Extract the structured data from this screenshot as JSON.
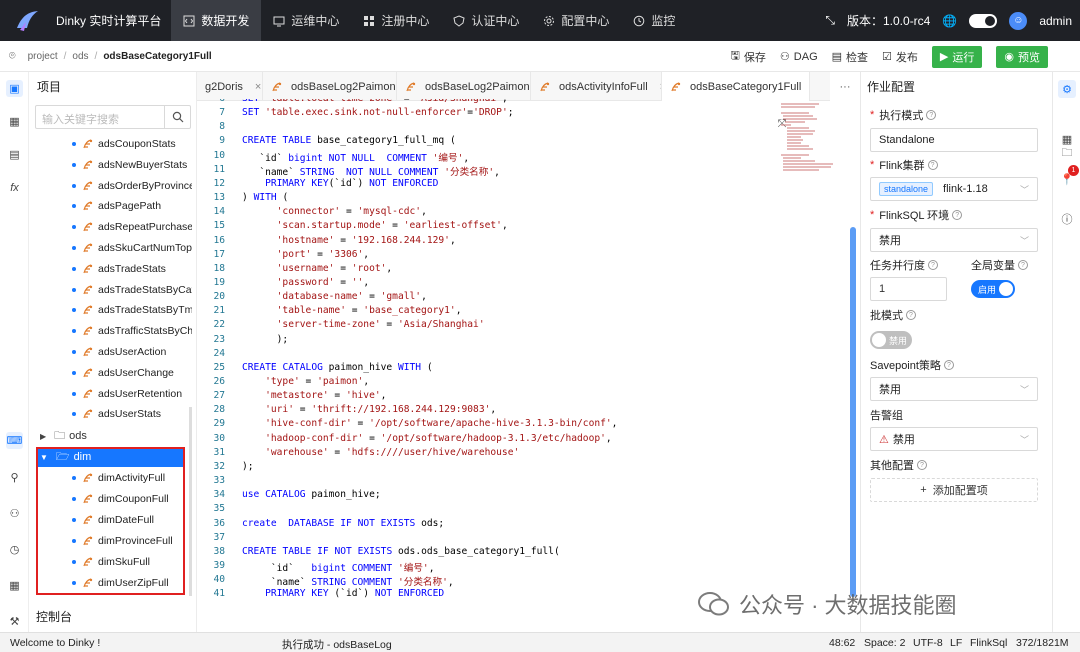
{
  "app": {
    "title": "Dinky 实时计算平台"
  },
  "nav": [
    {
      "label": "数据开发",
      "icon": "code-icon",
      "active": true
    },
    {
      "label": "运维中心",
      "icon": "monitor-icon"
    },
    {
      "label": "注册中心",
      "icon": "grid-icon"
    },
    {
      "label": "认证中心",
      "icon": "shield-icon"
    },
    {
      "label": "配置中心",
      "icon": "gear-icon"
    },
    {
      "label": "监控",
      "icon": "clock-icon"
    }
  ],
  "top_right": {
    "version": "版本：1.0.0-rc4",
    "user": "admin"
  },
  "breadcrumb": [
    "project",
    "ods",
    "odsBaseCategory1Full"
  ],
  "toolbar": {
    "save": "保存",
    "dag": "DAG",
    "check": "检查",
    "publish": "发布",
    "run": "运行",
    "preview": "预览"
  },
  "sidebar": {
    "title": "项目",
    "search_placeholder": "输入关键字搜索",
    "ads_items": [
      "adsCouponStats",
      "adsNewBuyerStats",
      "adsOrderByProvince",
      "adsPagePath",
      "adsRepeatPurchaseE",
      "adsSkuCartNumTop.",
      "adsTradeStats",
      "adsTradeStatsByCate",
      "adsTradeStatsByTm",
      "adsTrafficStatsByCha",
      "adsUserAction",
      "adsUserChange",
      "adsUserRetention",
      "adsUserStats"
    ],
    "folders": {
      "ods": "ods",
      "dim": "dim"
    },
    "dim_items": [
      "dimActivityFull",
      "dimCouponFull",
      "dimDateFull",
      "dimProvinceFull",
      "dimSkuFull",
      "dimUserZipFull"
    ],
    "console": "控制台"
  },
  "tabs": [
    {
      "label": "g2Doris",
      "active": false,
      "icon": false
    },
    {
      "label": "odsBaseLog2Paimon",
      "active": false,
      "icon": true
    },
    {
      "label": "odsBaseLog2Paimon",
      "active": false,
      "icon": true
    },
    {
      "label": "odsActivityInfoFull",
      "active": false,
      "icon": true
    },
    {
      "label": "odsBaseCategory1Full",
      "active": true,
      "icon": true
    }
  ],
  "code_lines": [
    {
      "n": "6",
      "t": "SET 'table.local-time-zone' = 'Asia/Shanghai';"
    },
    {
      "n": "7",
      "t": "SET 'table.exec.sink.not-null-enforcer'='DROP';"
    },
    {
      "n": "8",
      "t": ""
    },
    {
      "n": "9",
      "t": "CREATE TABLE base_category1_full_mq ("
    },
    {
      "n": "10",
      "t": "   `id` bigint NOT NULL  COMMENT '编号',"
    },
    {
      "n": "11",
      "t": "   `name` STRING  NOT NULL COMMENT '分类名称',"
    },
    {
      "n": "12",
      "t": "    PRIMARY KEY(`id`) NOT ENFORCED"
    },
    {
      "n": "13",
      "t": ") WITH ("
    },
    {
      "n": "14",
      "t": "      'connector' = 'mysql-cdc',"
    },
    {
      "n": "15",
      "t": "      'scan.startup.mode' = 'earliest-offset',"
    },
    {
      "n": "16",
      "t": "      'hostname' = '192.168.244.129',"
    },
    {
      "n": "17",
      "t": "      'port' = '3306',"
    },
    {
      "n": "18",
      "t": "      'username' = 'root',"
    },
    {
      "n": "19",
      "t": "      'password' = '',"
    },
    {
      "n": "20",
      "t": "      'database-name' = 'gmall',"
    },
    {
      "n": "21",
      "t": "      'table-name' = 'base_category1',"
    },
    {
      "n": "22",
      "t": "      'server-time-zone' = 'Asia/Shanghai'"
    },
    {
      "n": "23",
      "t": "      );"
    },
    {
      "n": "24",
      "t": ""
    },
    {
      "n": "25",
      "t": "CREATE CATALOG paimon_hive WITH ("
    },
    {
      "n": "26",
      "t": "    'type' = 'paimon',"
    },
    {
      "n": "27",
      "t": "    'metastore' = 'hive',"
    },
    {
      "n": "28",
      "t": "    'uri' = 'thrift://192.168.244.129:9083',"
    },
    {
      "n": "29",
      "t": "    'hive-conf-dir' = '/opt/software/apache-hive-3.1.3-bin/conf',"
    },
    {
      "n": "30",
      "t": "    'hadoop-conf-dir' = '/opt/software/hadoop-3.1.3/etc/hadoop',"
    },
    {
      "n": "31",
      "t": "    'warehouse' = 'hdfs:////user/hive/warehouse'"
    },
    {
      "n": "32",
      "t": ");"
    },
    {
      "n": "33",
      "t": ""
    },
    {
      "n": "34",
      "t": "use CATALOG paimon_hive;"
    },
    {
      "n": "35",
      "t": ""
    },
    {
      "n": "36",
      "t": "create  DATABASE IF NOT EXISTS ods;"
    },
    {
      "n": "37",
      "t": ""
    },
    {
      "n": "38",
      "t": "CREATE TABLE IF NOT EXISTS ods.ods_base_category1_full("
    },
    {
      "n": "39",
      "t": "     `id`   bigint COMMENT '编号',"
    },
    {
      "n": "40",
      "t": "     `name` STRING COMMENT '分类名称',"
    },
    {
      "n": "41",
      "t": "    PRIMARY KEY (`id`) NOT ENFORCED"
    }
  ],
  "job_config": {
    "title": "作业配置",
    "exec_mode_label": "执行模式",
    "exec_mode_value": "Standalone",
    "cluster_label": "Flink集群",
    "cluster_tag": "standalone",
    "cluster_value": "flink-1.18",
    "env_label": "FlinkSQL 环境",
    "env_value": "禁用",
    "parallel_label": "任务并行度",
    "parallel_value": "1",
    "global_var_label": "全局变量",
    "global_var_switch": "启用",
    "batch_label": "批模式",
    "batch_switch": "禁用",
    "savepoint_label": "Savepoint策略",
    "savepoint_value": "禁用",
    "alert_label": "告警组",
    "alert_value": "禁用",
    "other_label": "其他配置",
    "add_config": "添加配置项"
  },
  "right_rail": {
    "badge": "1"
  },
  "statusbar": {
    "welcome": "Welcome to Dinky !",
    "exec": "执行成功 - odsBaseLog",
    "cursor": "48:62",
    "space": "Space: 2",
    "encoding": "UTF-8",
    "eol": "LF",
    "lang": "FlinkSql",
    "memory": "372/1821M"
  },
  "watermark": {
    "text": "公众号 · 大数据技能圈"
  },
  "colors": {
    "topbar": "#1f2126",
    "accent": "#1677ff",
    "run_green": "#36b24a",
    "highlight_box": "#e02020"
  }
}
